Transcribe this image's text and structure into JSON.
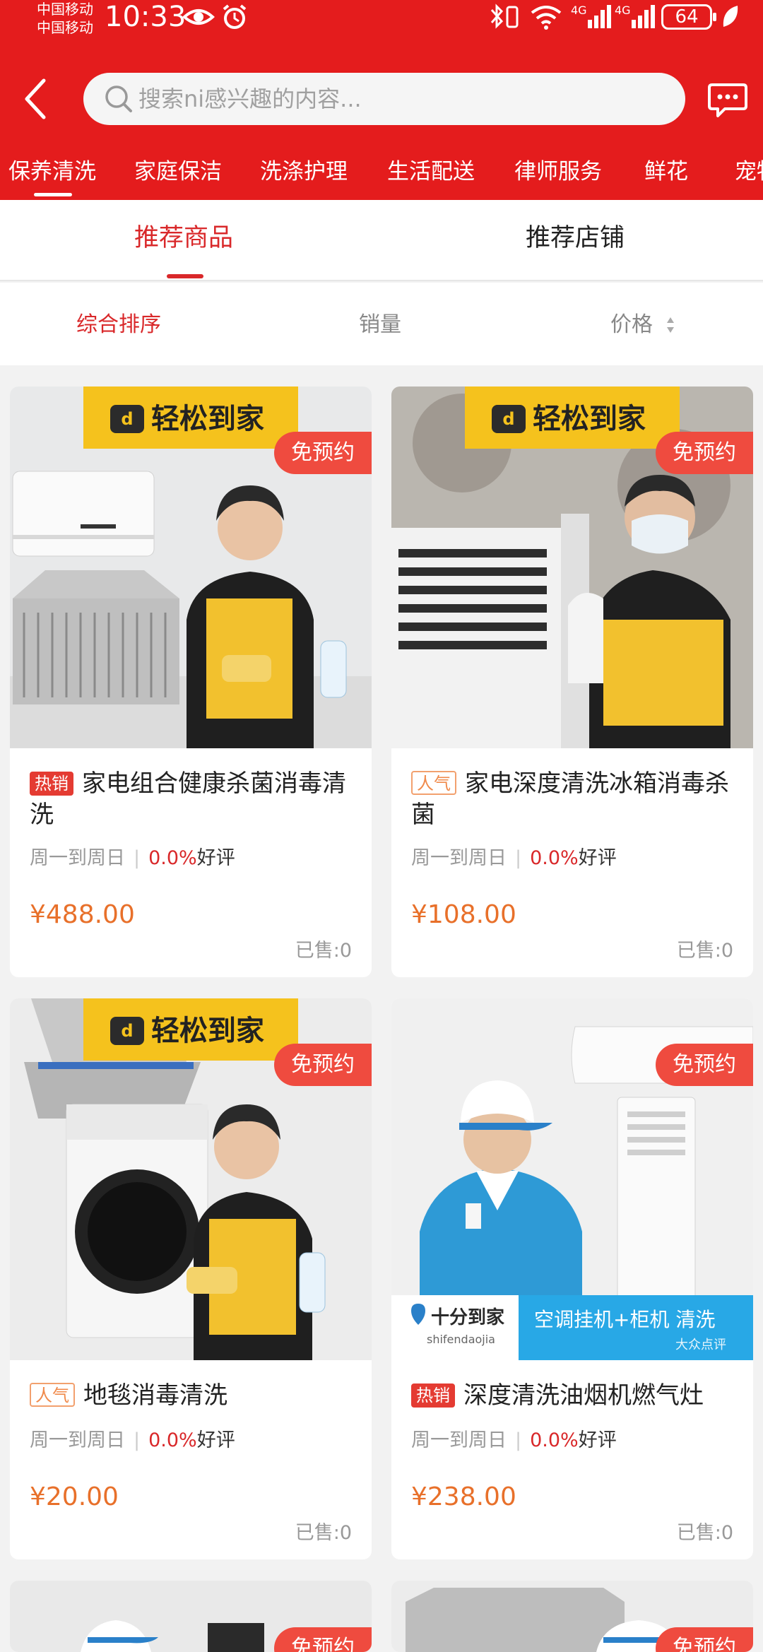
{
  "status_bar": {
    "carrier_1": "中国移动",
    "carrier_2": "中国移动",
    "time": "10:33",
    "battery": "64"
  },
  "search": {
    "placeholder": "搜索ni感兴趣的内容..."
  },
  "categories": [
    "保养清洗",
    "家庭保洁",
    "洗涤护理",
    "生活配送",
    "律师服务",
    "鲜花",
    "宠物"
  ],
  "tabs": {
    "products": "推荐商品",
    "shops": "推荐店铺"
  },
  "sort": {
    "overall": "综合排序",
    "sales": "销量",
    "price": "价格"
  },
  "products": [
    {
      "tag": "热销",
      "title": "家电组合健康杀菌消毒清洗",
      "schedule": "周一到周日",
      "rating": "0.0%",
      "rating_label": "好评",
      "price": "¥488.00",
      "sold": "已售:0",
      "badge": "免预约",
      "brand": "轻松到家"
    },
    {
      "tag": "人气",
      "title": "家电深度清洗冰箱消毒杀菌",
      "schedule": "周一到周日",
      "rating": "0.0%",
      "rating_label": "好评",
      "price": "¥108.00",
      "sold": "已售:0",
      "badge": "免预约",
      "brand": "轻松到家"
    },
    {
      "tag": "人气",
      "title": "地毯消毒清洗",
      "schedule": "周一到周日",
      "rating": "0.0%",
      "rating_label": "好评",
      "price": "¥20.00",
      "sold": "已售:0",
      "badge": "免预约",
      "brand": "轻松到家"
    },
    {
      "tag": "热销",
      "title": "深度清洗油烟机燃气灶",
      "schedule": "周一到周日",
      "rating": "0.0%",
      "rating_label": "好评",
      "price": "¥238.00",
      "sold": "已售:0",
      "badge": "免预约",
      "brand": "十分到家",
      "brand_sub": "shifendaojia",
      "banner_text": "空调挂机+柜机 清洗",
      "banner_sub": "大众点评"
    }
  ],
  "partial_badges": [
    "免预约",
    "免预约"
  ],
  "colors": {
    "header_red": "#e41c1d",
    "accent_red": "#d9282a",
    "price_orange": "#e8702a",
    "badge_red": "#ef4b3f",
    "brand_yellow": "#f5c21d"
  },
  "icons": [
    "back-arrow-icon",
    "search-icon",
    "message-icon",
    "sort-arrows-icon",
    "eye-icon",
    "alarm-icon",
    "bluetooth-icon",
    "wifi-icon",
    "signal-icon",
    "leaf-icon"
  ]
}
